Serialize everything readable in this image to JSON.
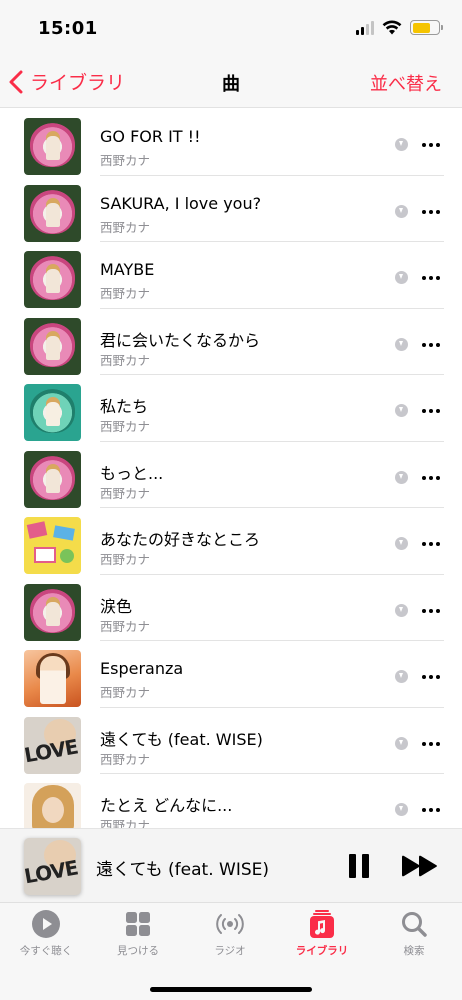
{
  "status_bar": {
    "time": "15:01",
    "battery_level": 0.7,
    "battery_color": "#f5c400"
  },
  "nav": {
    "back_label": "ライブラリ",
    "title": "曲",
    "sort_label": "並べ替え",
    "accent_color": "#fa2d48"
  },
  "songs": [
    {
      "title": "GO FOR IT !!",
      "artist": "西野カナ",
      "art": "heart-pink"
    },
    {
      "title": "SAKURA, I love you?",
      "artist": "西野カナ",
      "art": "heart-pink"
    },
    {
      "title": "MAYBE",
      "artist": "西野カナ",
      "art": "heart-pink"
    },
    {
      "title": "君に会いたくなるから",
      "artist": "西野カナ",
      "art": "heart-pink"
    },
    {
      "title": "私たち",
      "artist": "西野カナ",
      "art": "heart-teal"
    },
    {
      "title": "もっと...",
      "artist": "西野カナ",
      "art": "heart-pink"
    },
    {
      "title": "あなたの好きなところ",
      "artist": "西野カナ",
      "art": "yellow-collage"
    },
    {
      "title": "涙色",
      "artist": "西野カナ",
      "art": "heart-pink"
    },
    {
      "title": "Esperanza",
      "artist": "西野カナ",
      "art": "orange-portrait"
    },
    {
      "title": "遠くても (feat. WISE)",
      "artist": "西野カナ",
      "art": "love-cover"
    },
    {
      "title": "たとえ どんなに...",
      "artist": "西野カナ",
      "art": "blonde-portrait"
    }
  ],
  "mini_player": {
    "title": "遠くても (feat. WISE)",
    "art": "love-cover",
    "state": "playing"
  },
  "tabs": [
    {
      "label": "今すぐ聴く",
      "icon": "play-circle-icon",
      "active": false
    },
    {
      "label": "見つける",
      "icon": "grid-icon",
      "active": false
    },
    {
      "label": "ラジオ",
      "icon": "radio-icon",
      "active": false
    },
    {
      "label": "ライブラリ",
      "icon": "music-library-icon",
      "active": true
    },
    {
      "label": "検索",
      "icon": "search-icon",
      "active": false
    }
  ]
}
